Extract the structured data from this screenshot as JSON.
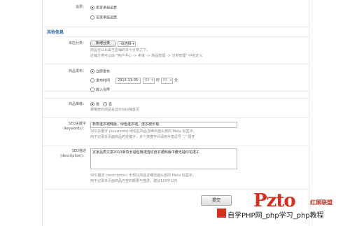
{
  "shipping": {
    "label": "运费：",
    "option_seller": "卖家承担运费",
    "option_buyer": "买家承担运费"
  },
  "section_title": "其他信息",
  "category": {
    "label": "本店分类：",
    "add_button": "新增分类",
    "select_value": "-请选择-",
    "hint1": "商品可以从属于店铺的多个分类之下。",
    "hint2": "店铺分类可以由 \"用户中心 -> 卖家 -> 商品管理 -> 分类管理\" 中自定义"
  },
  "publish": {
    "label": "商品发布：",
    "option_now": "立即发布",
    "option_scheduled": "发布时间",
    "date_value": "2013-11-05",
    "hour_value": "09",
    "hour_unit": "时",
    "minute_value": "05",
    "minute_unit": "分",
    "option_warehouse": "放入仓库"
  },
  "recommend": {
    "label": "商品推荐：",
    "option_yes": "是",
    "option_no": "否",
    "hint": "被推荐的商品会显示在店铺首页"
  },
  "seo_keywords": {
    "label": "SEO关键字",
    "label2": "(keywords)：",
    "value": "新款连衣裙韩版，绿色连衣裙，连衣裙长袖",
    "hint1": "SEO关键字 (keywords) 出现在商品详细页面头部的 Meta 标签中，",
    "hint2": "用于记录本页面商品的关键字，多个关键字间请用半角逗号 \",\" 隔开"
  },
  "seo_description": {
    "label": "SEO描述",
    "label2": "(description)：",
    "value": "定家品质文案2013新款长袖包臀裙雪纺连衣裙韩版中腰无袖印花裙子",
    "hint1": "SEO描述 (description) 出现在商品详细页面头部的 Meta 标签中，",
    "hint2": "用于记录本页面商品内容的概要与描述，建议120字以内"
  },
  "submit_label": "提交",
  "watermark": {
    "logo": "Pzto",
    "logo_sub": "红黑联盟",
    "text": "自学PHP网_php学习_php教程"
  },
  "colors": {
    "link_blue": "#2a6aa8",
    "logo_red": "#d43020",
    "border": "#b9b9b9"
  }
}
